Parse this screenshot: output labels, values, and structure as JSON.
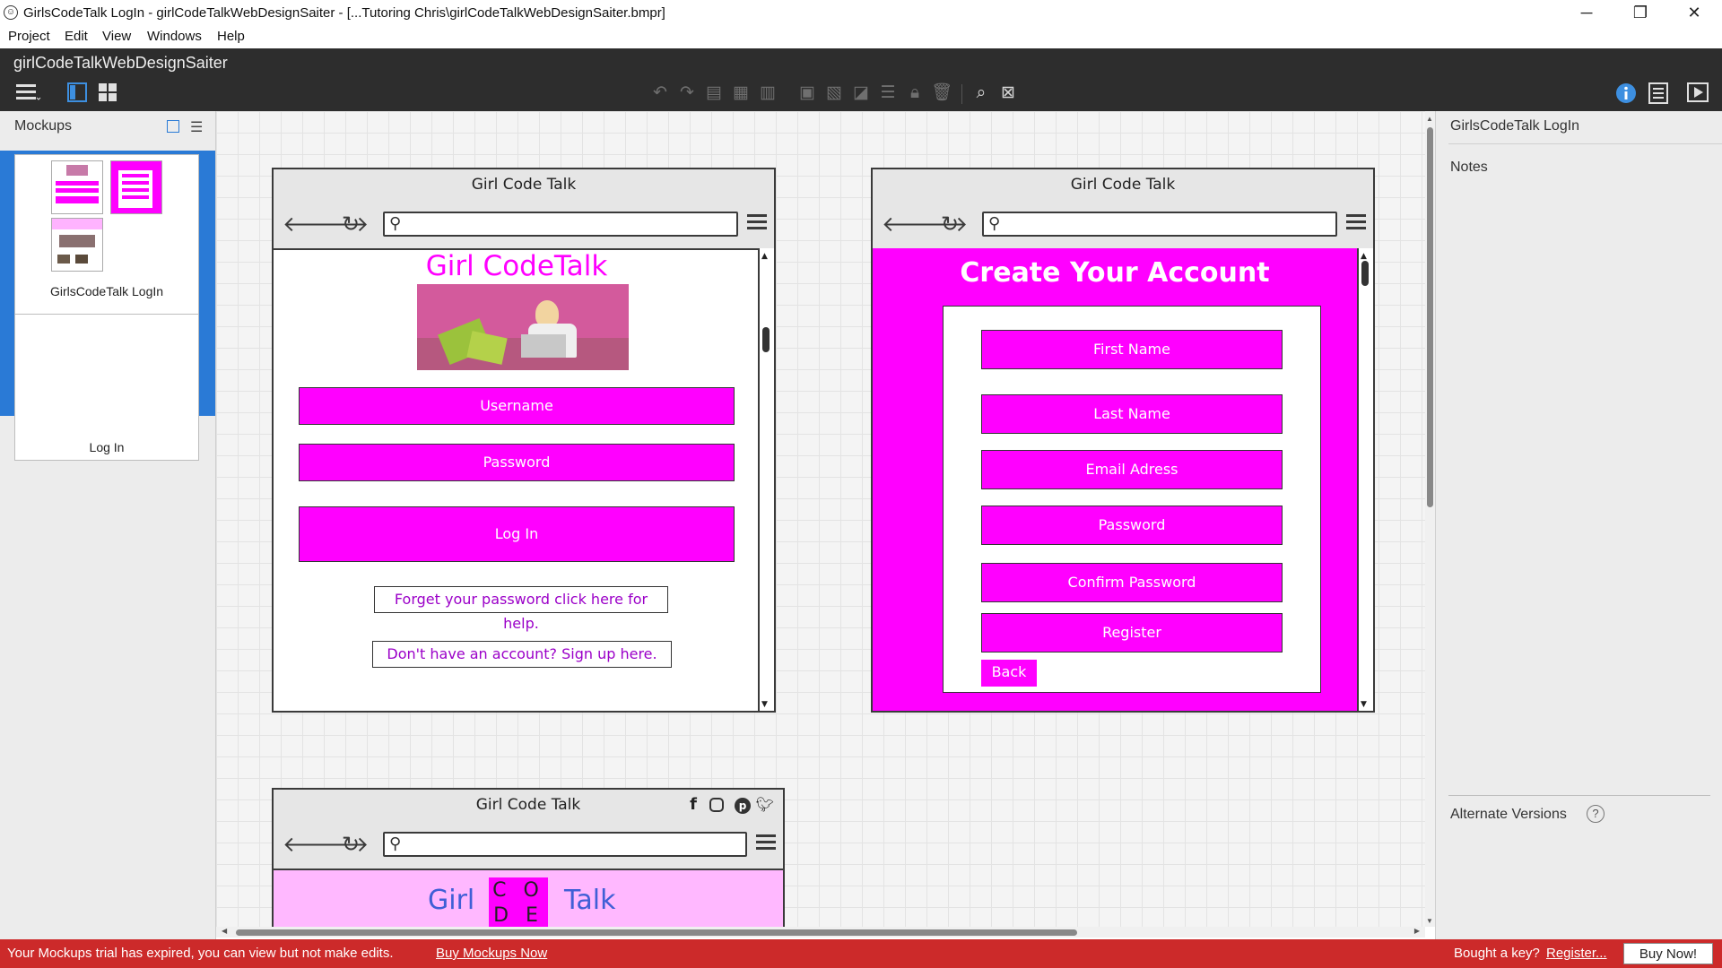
{
  "window": {
    "title": "GirlsCodeTalk LogIn - girlCodeTalkWebDesignSaiter - [...Tutoring Chris\\girlCodeTalkWebDesignSaiter.bmpr]",
    "controls": {
      "minimize": "─",
      "restore": "❐",
      "close": "✕"
    }
  },
  "menu": [
    "Project",
    "Edit",
    "View",
    "Windows",
    "Help"
  ],
  "project_name": "girlCodeTalkWebDesignSaiter",
  "toolbar": {
    "icons": [
      "hamburger-menu-icon",
      "single-view-icon",
      "grid-view-icon",
      "undo-icon",
      "redo-icon",
      "copy-icon",
      "paste-icon",
      "clipboard-icon",
      "group-icon",
      "ungroup-icon",
      "front-icon",
      "align-icon",
      "lock-icon",
      "delete-icon",
      "find-icon",
      "clear-icon",
      "info-icon",
      "properties-icon",
      "present-icon"
    ]
  },
  "left_panel": {
    "title": "Mockups",
    "items": [
      {
        "label": "GirlsCodeTalk LogIn",
        "selected": true
      },
      {
        "label": "Log In",
        "selected": false
      }
    ]
  },
  "mockups": {
    "login": {
      "window_title": "Girl Code Talk",
      "heading": "Girl CodeTalk",
      "username": "Username",
      "password": "Password",
      "login_button": "Log In",
      "forgot_link": "Forget your password click here for help.",
      "signup_link": "Don't have an account? Sign up here."
    },
    "register": {
      "window_title": "Girl Code Talk",
      "heading": "Create Your Account",
      "fields": [
        "First Name",
        "Last Name",
        "Email Adress",
        "Password",
        "Confirm Password"
      ],
      "register_button": "Register",
      "back_button": "Back"
    },
    "home": {
      "window_title": "Girl Code Talk",
      "social_icons": [
        "facebook-icon",
        "instagram-icon",
        "pinterest-icon",
        "twitter-icon"
      ],
      "logo_left": "Girl",
      "logo_box_top": "C O",
      "logo_box_bottom": "D E",
      "logo_right": "Talk"
    }
  },
  "right_panel": {
    "title": "GirlsCodeTalk LogIn",
    "notes_label": "Notes",
    "alternate_versions_label": "Alternate Versions",
    "help_symbol": "?"
  },
  "trial_bar": {
    "message": "Your Mockups trial has expired, you can view but not make edits.",
    "buy_link": "Buy Mockups Now",
    "key_question": "Bought a key?",
    "register_link": "Register...",
    "buy_button": "Buy Now!"
  },
  "colors": {
    "accent_magenta": "#ff00ff",
    "selection_blue": "#2a7ad6",
    "trial_red": "#cc2a2a",
    "app_header": "#2d2d2d"
  }
}
